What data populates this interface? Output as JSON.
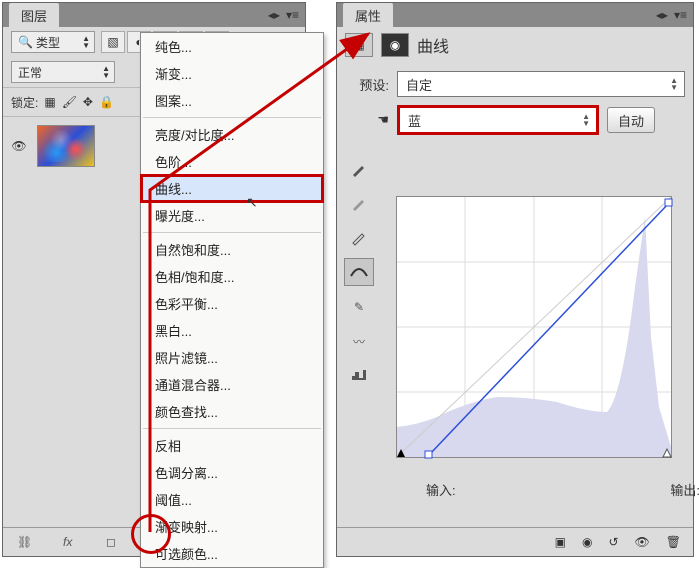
{
  "layers_panel": {
    "title": "图层",
    "type_filter_label": "类型",
    "blend_mode": "正常",
    "lock_label": "锁定:",
    "layer_name": ""
  },
  "adjustment_menu": {
    "items": [
      "纯色...",
      "渐变...",
      "图案...",
      "-",
      "亮度/对比度...",
      "色阶...",
      "曲线...",
      "曝光度...",
      "-",
      "自然饱和度...",
      "色相/饱和度...",
      "色彩平衡...",
      "黑白...",
      "照片滤镜...",
      "通道混合器...",
      "颜色查找...",
      "-",
      "反相",
      "色调分离...",
      "阈值...",
      "渐变映射...",
      "可选颜色..."
    ],
    "selected_index": 6
  },
  "props_panel": {
    "title": "属性",
    "adjustment_title": "曲线",
    "preset_label": "预设:",
    "preset_value": "自定",
    "channel_value": "蓝",
    "auto_button": "自动",
    "input_label": "输入:",
    "output_label": "输出:"
  },
  "chart_data": {
    "type": "line",
    "title": "曲线",
    "xlabel": "输入",
    "ylabel": "输出",
    "xlim": [
      0,
      255
    ],
    "ylim": [
      0,
      255
    ],
    "series": [
      {
        "name": "蓝",
        "points": [
          {
            "x": 30,
            "y": 0
          },
          {
            "x": 255,
            "y": 255
          }
        ]
      }
    ],
    "histogram_approx_note": "shaded histogram shown behind curve, low on left rising to a tall spike near x≈240"
  }
}
